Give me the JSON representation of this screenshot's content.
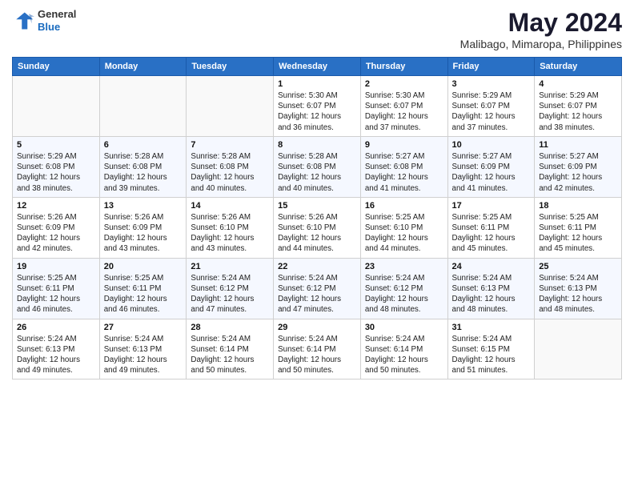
{
  "logo": {
    "general": "General",
    "blue": "Blue"
  },
  "title": "May 2024",
  "subtitle": "Malibago, Mimaropa, Philippines",
  "days_header": [
    "Sunday",
    "Monday",
    "Tuesday",
    "Wednesday",
    "Thursday",
    "Friday",
    "Saturday"
  ],
  "weeks": [
    [
      {
        "day": "",
        "info": ""
      },
      {
        "day": "",
        "info": ""
      },
      {
        "day": "",
        "info": ""
      },
      {
        "day": "1",
        "info": "Sunrise: 5:30 AM\nSunset: 6:07 PM\nDaylight: 12 hours\nand 36 minutes."
      },
      {
        "day": "2",
        "info": "Sunrise: 5:30 AM\nSunset: 6:07 PM\nDaylight: 12 hours\nand 37 minutes."
      },
      {
        "day": "3",
        "info": "Sunrise: 5:29 AM\nSunset: 6:07 PM\nDaylight: 12 hours\nand 37 minutes."
      },
      {
        "day": "4",
        "info": "Sunrise: 5:29 AM\nSunset: 6:07 PM\nDaylight: 12 hours\nand 38 minutes."
      }
    ],
    [
      {
        "day": "5",
        "info": "Sunrise: 5:29 AM\nSunset: 6:08 PM\nDaylight: 12 hours\nand 38 minutes."
      },
      {
        "day": "6",
        "info": "Sunrise: 5:28 AM\nSunset: 6:08 PM\nDaylight: 12 hours\nand 39 minutes."
      },
      {
        "day": "7",
        "info": "Sunrise: 5:28 AM\nSunset: 6:08 PM\nDaylight: 12 hours\nand 40 minutes."
      },
      {
        "day": "8",
        "info": "Sunrise: 5:28 AM\nSunset: 6:08 PM\nDaylight: 12 hours\nand 40 minutes."
      },
      {
        "day": "9",
        "info": "Sunrise: 5:27 AM\nSunset: 6:08 PM\nDaylight: 12 hours\nand 41 minutes."
      },
      {
        "day": "10",
        "info": "Sunrise: 5:27 AM\nSunset: 6:09 PM\nDaylight: 12 hours\nand 41 minutes."
      },
      {
        "day": "11",
        "info": "Sunrise: 5:27 AM\nSunset: 6:09 PM\nDaylight: 12 hours\nand 42 minutes."
      }
    ],
    [
      {
        "day": "12",
        "info": "Sunrise: 5:26 AM\nSunset: 6:09 PM\nDaylight: 12 hours\nand 42 minutes."
      },
      {
        "day": "13",
        "info": "Sunrise: 5:26 AM\nSunset: 6:09 PM\nDaylight: 12 hours\nand 43 minutes."
      },
      {
        "day": "14",
        "info": "Sunrise: 5:26 AM\nSunset: 6:10 PM\nDaylight: 12 hours\nand 43 minutes."
      },
      {
        "day": "15",
        "info": "Sunrise: 5:26 AM\nSunset: 6:10 PM\nDaylight: 12 hours\nand 44 minutes."
      },
      {
        "day": "16",
        "info": "Sunrise: 5:25 AM\nSunset: 6:10 PM\nDaylight: 12 hours\nand 44 minutes."
      },
      {
        "day": "17",
        "info": "Sunrise: 5:25 AM\nSunset: 6:11 PM\nDaylight: 12 hours\nand 45 minutes."
      },
      {
        "day": "18",
        "info": "Sunrise: 5:25 AM\nSunset: 6:11 PM\nDaylight: 12 hours\nand 45 minutes."
      }
    ],
    [
      {
        "day": "19",
        "info": "Sunrise: 5:25 AM\nSunset: 6:11 PM\nDaylight: 12 hours\nand 46 minutes."
      },
      {
        "day": "20",
        "info": "Sunrise: 5:25 AM\nSunset: 6:11 PM\nDaylight: 12 hours\nand 46 minutes."
      },
      {
        "day": "21",
        "info": "Sunrise: 5:24 AM\nSunset: 6:12 PM\nDaylight: 12 hours\nand 47 minutes."
      },
      {
        "day": "22",
        "info": "Sunrise: 5:24 AM\nSunset: 6:12 PM\nDaylight: 12 hours\nand 47 minutes."
      },
      {
        "day": "23",
        "info": "Sunrise: 5:24 AM\nSunset: 6:12 PM\nDaylight: 12 hours\nand 48 minutes."
      },
      {
        "day": "24",
        "info": "Sunrise: 5:24 AM\nSunset: 6:13 PM\nDaylight: 12 hours\nand 48 minutes."
      },
      {
        "day": "25",
        "info": "Sunrise: 5:24 AM\nSunset: 6:13 PM\nDaylight: 12 hours\nand 48 minutes."
      }
    ],
    [
      {
        "day": "26",
        "info": "Sunrise: 5:24 AM\nSunset: 6:13 PM\nDaylight: 12 hours\nand 49 minutes."
      },
      {
        "day": "27",
        "info": "Sunrise: 5:24 AM\nSunset: 6:13 PM\nDaylight: 12 hours\nand 49 minutes."
      },
      {
        "day": "28",
        "info": "Sunrise: 5:24 AM\nSunset: 6:14 PM\nDaylight: 12 hours\nand 50 minutes."
      },
      {
        "day": "29",
        "info": "Sunrise: 5:24 AM\nSunset: 6:14 PM\nDaylight: 12 hours\nand 50 minutes."
      },
      {
        "day": "30",
        "info": "Sunrise: 5:24 AM\nSunset: 6:14 PM\nDaylight: 12 hours\nand 50 minutes."
      },
      {
        "day": "31",
        "info": "Sunrise: 5:24 AM\nSunset: 6:15 PM\nDaylight: 12 hours\nand 51 minutes."
      },
      {
        "day": "",
        "info": ""
      }
    ]
  ]
}
